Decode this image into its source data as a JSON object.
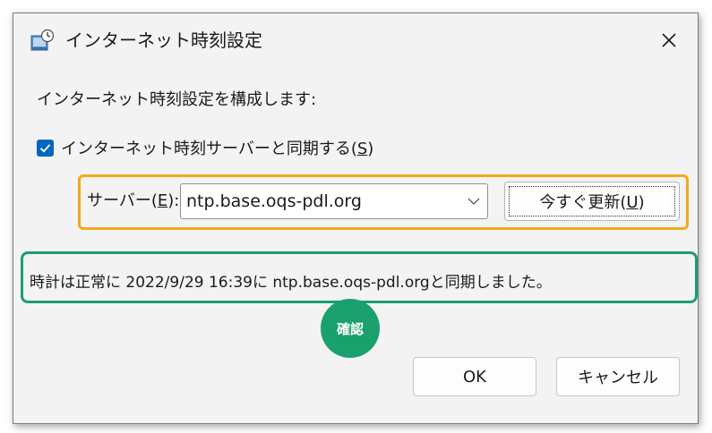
{
  "window": {
    "title": "インターネット時刻設定",
    "icon": "clock-settings-icon",
    "close_icon": "close-icon"
  },
  "instruction": "インターネット時刻設定を構成します:",
  "sync_checkbox": {
    "checked": true,
    "label": "インターネット時刻サーバーと同期する(",
    "accel": "S",
    "label_end": ")"
  },
  "server": {
    "label": "サーバー(",
    "accel": "E",
    "label_end": "):",
    "value": "ntp.base.oqs-pdl.org"
  },
  "update_button": {
    "label": "今すぐ更新(",
    "accel": "U",
    "label_end": ")"
  },
  "status": "時計は正常に 2022/9/29 16:39に ntp.base.oqs-pdl.orgと同期しました。",
  "badge": "確認",
  "buttons": {
    "ok": "OK",
    "cancel": "キャンセル"
  },
  "colors": {
    "highlight_server": "#f2a81d",
    "highlight_status": "#1aa06d",
    "checkbox": "#0067c0"
  }
}
